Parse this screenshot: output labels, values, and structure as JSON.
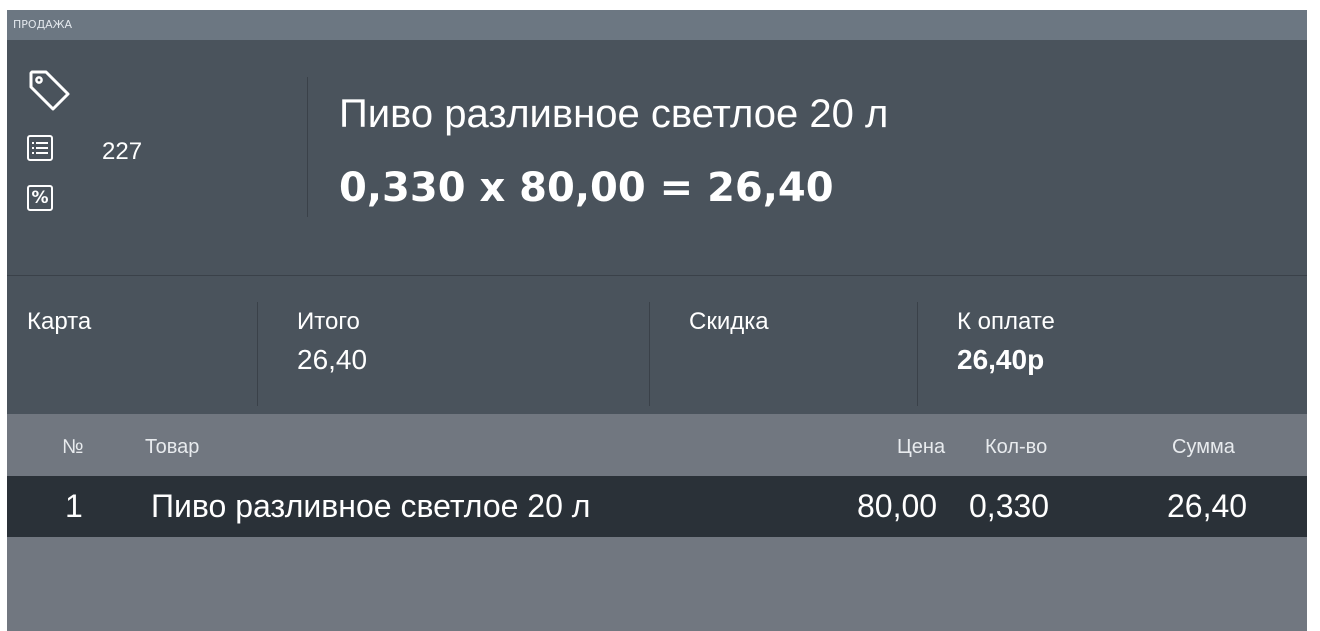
{
  "window": {
    "title": "ПРОДАЖА"
  },
  "current_item": {
    "tag_icon": "tag-icon",
    "list_icon": "list-icon",
    "percent_icon": "percent-icon",
    "percent_glyph": "%",
    "counter": "227",
    "name": "Пиво разливное светлое 20 л",
    "calculation": "0,330 x 80,00 = 26,40"
  },
  "summary": {
    "card_label": "Карта",
    "total_label": "Итого",
    "total_value": "26,40",
    "discount_label": "Скидка",
    "to_pay_label": "К оплате",
    "to_pay_value": "26,40р"
  },
  "table": {
    "columns": {
      "num": "№",
      "item": "Товар",
      "price": "Цена",
      "qty": "Кол-во",
      "sum": "Сумма"
    },
    "rows": [
      {
        "num": "1",
        "item": "Пиво разливное светлое 20 л",
        "price": "80,00",
        "qty": "0,330",
        "sum": "26,40"
      }
    ]
  },
  "colors": {
    "title_bar": "#6c7782",
    "panel": "#4a535c",
    "selected_row": "#2a3138",
    "table_bg": "#717780"
  }
}
